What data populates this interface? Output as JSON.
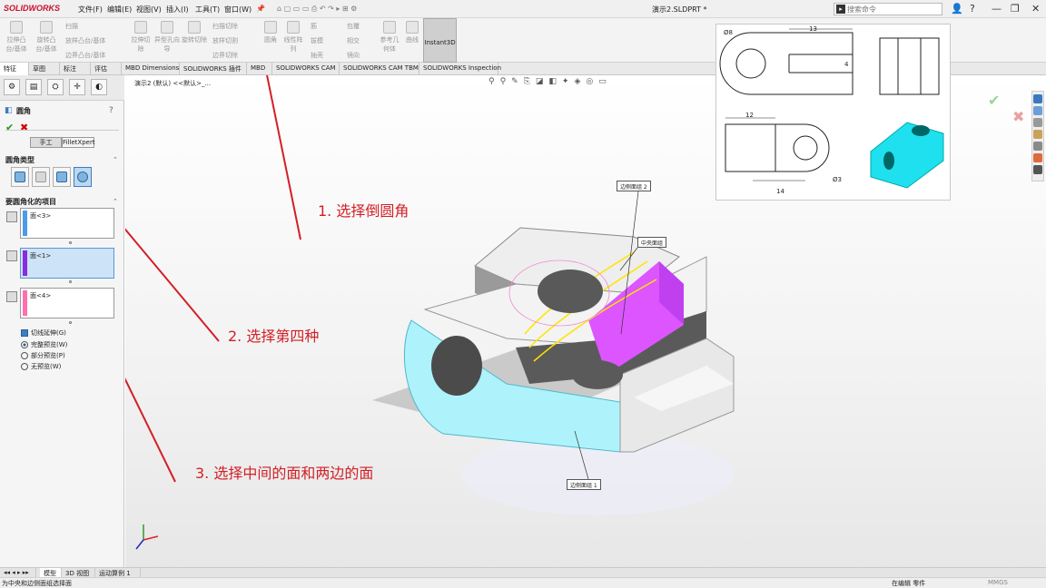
{
  "app": {
    "logo": "SOLIDWORKS",
    "menus": [
      "文件(F)",
      "编辑(E)",
      "视图(V)",
      "插入(I)",
      "工具(T)",
      "窗口(W)"
    ],
    "document_title": "演示2.SLDPRT *",
    "search_placeholder": "搜索命令"
  },
  "toolbar": {
    "buttons": [
      "拉伸凸台/基体",
      "旋转凸台/基体",
      "扫描",
      "放样凸台/基体",
      "边界凸台/基体",
      "拉伸切除",
      "异型孔向导",
      "旋转切除",
      "扫描切除",
      "放样切割",
      "边界切除",
      "圆角",
      "线性阵列",
      "筋",
      "拔模",
      "抽壳",
      "包覆",
      "相交",
      "镜向",
      "参考几何体",
      "曲线",
      "Instant3D"
    ]
  },
  "command_tabs": [
    "特征",
    "草图",
    "标注",
    "评估",
    "MBD Dimensions",
    "SOLIDWORKS 插件",
    "MBD",
    "SOLIDWORKS CAM",
    "SOLIDWORKS CAM TBM",
    "SOLIDWORKS Inspection"
  ],
  "property_manager": {
    "title": "圆角",
    "modes": [
      "手工",
      "FilletXpert"
    ],
    "fillet_type_header": "圆角类型",
    "items_header": "要圆角化的项目",
    "faces": [
      "面<3>",
      "面<1>",
      "面<4>"
    ],
    "face_colors": [
      "#4a9be8",
      "#8a2be2",
      "#ff6fb0"
    ],
    "tangent_propagation": "切线延伸(G)",
    "preview_options": [
      "完整预览(W)",
      "部分预览(P)",
      "无预览(W)"
    ]
  },
  "viewport": {
    "breadcrumb": "演示2 (默认) <<默认>_...",
    "callouts": [
      "边侧面组 2",
      "中央面组",
      "边侧面组 1"
    ]
  },
  "drawing": {
    "dims": [
      "13",
      "4",
      "12",
      "14",
      "Ø8",
      "Ø3"
    ]
  },
  "annotations": {
    "step1": "1. 选择倒圆角",
    "step2": "2. 选择第四种",
    "step3": "3. 选择中间的面和两边的面",
    "color": "#d21f26"
  },
  "bottom_tabs": [
    "模型",
    "3D 视图",
    "运动算例 1"
  ],
  "status": {
    "message": "为中央和边侧面组选择面",
    "mode": "在编辑 零件",
    "units": "MMGS"
  }
}
